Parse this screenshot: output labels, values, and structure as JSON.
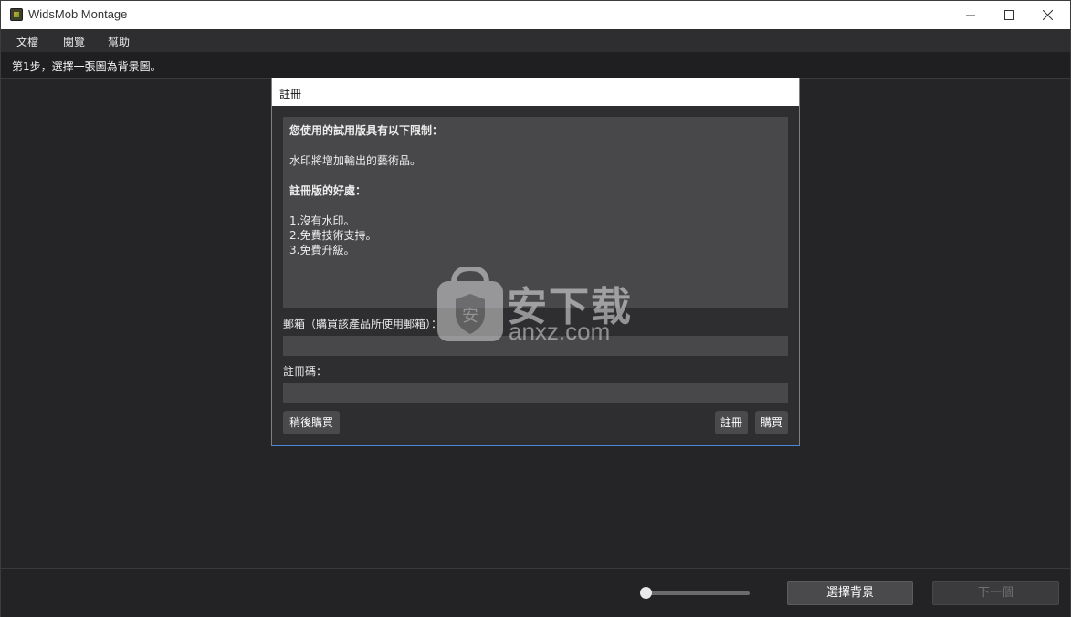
{
  "window": {
    "title": "WidsMob Montage"
  },
  "menu": {
    "items": [
      "文檔",
      "閱覽",
      "幫助"
    ]
  },
  "step": {
    "text": "第1步，選擇一張圖為背景圖。"
  },
  "dialog": {
    "title": "註冊",
    "info": {
      "heading1": "您使用的試用版具有以下限制：",
      "line1": "水印將增加輸出的藝術品。",
      "heading2": "註冊版的好處：",
      "benefits": [
        "1.沒有水印。",
        "2.免費技術支持。",
        "3.免費升級。"
      ]
    },
    "email_label": "郵箱（購買該產品所使用郵箱）：",
    "email_value": "",
    "code_label": "註冊碼：",
    "code_value": "",
    "buttons": {
      "later": "稍後購買",
      "register": "註冊",
      "buy": "購買"
    }
  },
  "bottom": {
    "slider_value": 0,
    "select_bg": "選擇背景",
    "next": "下一個"
  },
  "watermark": {
    "cn": "安下载",
    "en": "anxz.com"
  }
}
